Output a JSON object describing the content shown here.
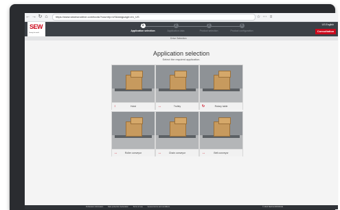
{
  "browser": {
    "url": "https://www.seweurodrive.com/tools/?country=US&language=en_US",
    "icons": [
      "back-icon",
      "forward-icon",
      "reload-icon",
      "home-icon"
    ]
  },
  "header": {
    "logo_text": "SEW",
    "logo_slogan": "Driving the world",
    "steps": [
      {
        "number": "1",
        "label": "Application selection"
      },
      {
        "number": "2",
        "label": "Application data"
      },
      {
        "number": "3",
        "label": "Product selection"
      },
      {
        "number": "4",
        "label": "Product configuration"
      }
    ],
    "language": "US  English",
    "consultation_label": "Consultation"
  },
  "subnav": {
    "label": "Drive Selection"
  },
  "main": {
    "title": "Application selection",
    "subtitle": "Select the required application."
  },
  "applications": [
    {
      "label": "Hoist",
      "icon": "↕"
    },
    {
      "label": "Trolley",
      "icon": "↔"
    },
    {
      "label": "Rotary table",
      "icon": "↻"
    },
    {
      "label": "Roller conveyor",
      "icon": "↔"
    },
    {
      "label": "Chain conveyor",
      "icon": "↔"
    },
    {
      "label": "Belt conveyor",
      "icon": "↔"
    }
  ],
  "footer": {
    "links": [
      "Publication information",
      "Data protection declaration",
      "Terms of use",
      "General terms and conditions"
    ],
    "copyright": "© 2024 SEW-EURODRIVE"
  },
  "colors": {
    "brand_red": "#cc0a1d",
    "header_bg": "#3c4147",
    "footer_bg": "#2f3237"
  }
}
